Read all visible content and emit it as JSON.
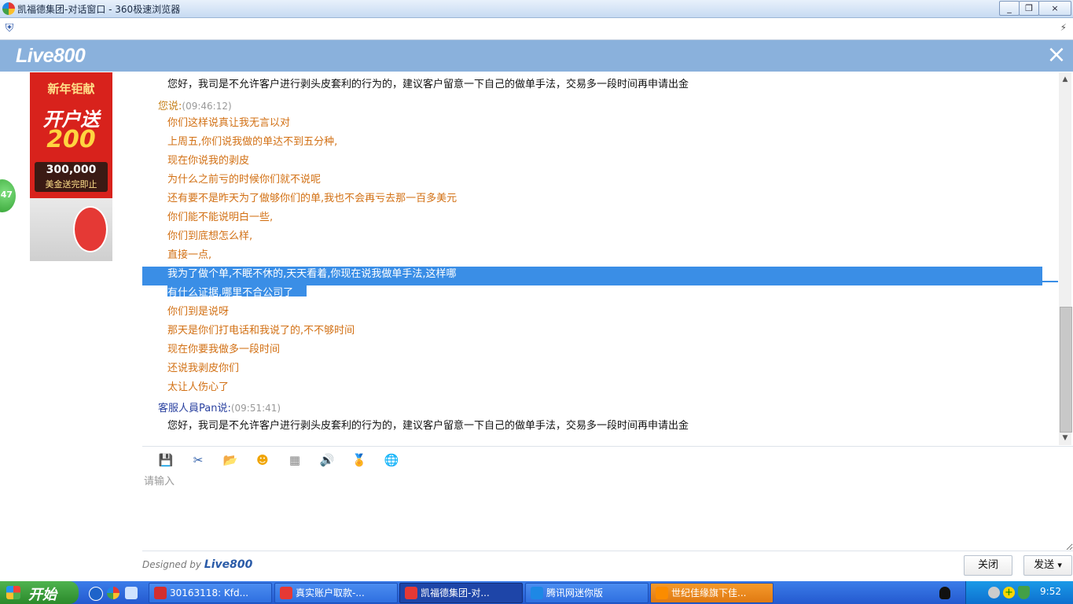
{
  "window": {
    "title": "凯福德集团-对话窗口 - 360极速浏览器",
    "controls": [
      "_",
      "❐",
      "×"
    ]
  },
  "header": {
    "logo": "Live800",
    "close": "×"
  },
  "banner": {
    "line1": "新年钜献",
    "line2": "开户送",
    "line3": "200",
    "line4": "300,000",
    "line5": "美金送完即止"
  },
  "side_badge": "47",
  "chat": {
    "messages": [
      {
        "kind": "text",
        "style": "black",
        "text": "您好，我司是不允许客户进行剥头皮套利的行为的，建议客户留意一下自己的做单手法，交易多一段时间再申请出金"
      },
      {
        "kind": "head",
        "who": "you",
        "speaker": "您说:",
        "time": "(09:46:12)"
      },
      {
        "kind": "text",
        "style": "orange",
        "text": "你们这样说真让我无言以对"
      },
      {
        "kind": "text",
        "style": "orange",
        "text": "上周五,你们说我做的单达不到五分种,"
      },
      {
        "kind": "text",
        "style": "orange",
        "text": "现在你说我的剥皮"
      },
      {
        "kind": "text",
        "style": "orange",
        "text": "为什么之前亏的时候你们就不说呢"
      },
      {
        "kind": "text",
        "style": "orange",
        "text": "还有要不是昨天为了做够你们的单,我也不会再亏去那一百多美元"
      },
      {
        "kind": "text",
        "style": "orange",
        "text": "你们能不能说明白一些,"
      },
      {
        "kind": "text",
        "style": "orange",
        "text": "你们到底想怎么样,"
      },
      {
        "kind": "text",
        "style": "orange",
        "text": "直接一点,"
      },
      {
        "kind": "text",
        "style": "sel",
        "text": "我为了做个单,不眠不休的,天天看着,你现在说我做单手法,这样哪"
      },
      {
        "kind": "text",
        "style": "sel",
        "text": "有什么证据,哪里不合公司了"
      },
      {
        "kind": "text",
        "style": "orange",
        "text": "你们到是说呀"
      },
      {
        "kind": "text",
        "style": "orange",
        "text": "那天是你们打电话和我说了的,不不够时间"
      },
      {
        "kind": "text",
        "style": "orange",
        "text": "现在你要我做多一段时间"
      },
      {
        "kind": "text",
        "style": "orange",
        "text": "还说我剥皮你们"
      },
      {
        "kind": "text",
        "style": "orange",
        "text": "太让人伤心了"
      },
      {
        "kind": "head",
        "who": "agent",
        "speaker": "客服人員Pan说:",
        "time": "(09:51:41)"
      },
      {
        "kind": "text",
        "style": "black",
        "text": "您好，我司是不允许客户进行剥头皮套利的行为的，建议客户留意一下自己的做单手法，交易多一段时间再申请出金"
      }
    ]
  },
  "toolbar": {
    "icons": [
      {
        "name": "save-icon",
        "glyph": "💾",
        "color": "#2a5ba8"
      },
      {
        "name": "screenshot-scissors-icon",
        "glyph": "✂",
        "color": "#2a5ba8"
      },
      {
        "name": "folder-icon",
        "glyph": "📂",
        "color": "#d9a21b"
      },
      {
        "name": "emoji-icon",
        "glyph": "☻",
        "color": "#f0a400"
      },
      {
        "name": "calculator-icon",
        "glyph": "▦",
        "color": "#888"
      },
      {
        "name": "sound-icon",
        "glyph": "🔊",
        "color": "#e1a000"
      },
      {
        "name": "badge-icon",
        "glyph": "🏅",
        "color": "#e39a1a"
      },
      {
        "name": "globe-icon",
        "glyph": "🌐",
        "color": "#2a6fd0"
      }
    ]
  },
  "input": {
    "placeholder": "请输入"
  },
  "footer": {
    "designed_prefix": "Designed by",
    "designed_brand": "Live800",
    "close_label": "关闭",
    "send_label": "发送",
    "send_arrow": "▾"
  },
  "taskbar": {
    "start_label": "开始",
    "tasks": [
      {
        "label": "30163118: Kfd...",
        "icon_color": "#d32f2f",
        "active": false
      },
      {
        "label": "真实账户取款-...",
        "icon_color": "#e53935",
        "active": false
      },
      {
        "label": "凯福德集团-对...",
        "icon_color": "#e53935",
        "active": true
      },
      {
        "label": "腾讯网迷你版",
        "icon_color": "#1e88e5",
        "active": false
      },
      {
        "label": "世纪佳缘旗下佳...",
        "icon_color": "#fb8c00",
        "active": false
      }
    ],
    "clock": "9:52"
  }
}
